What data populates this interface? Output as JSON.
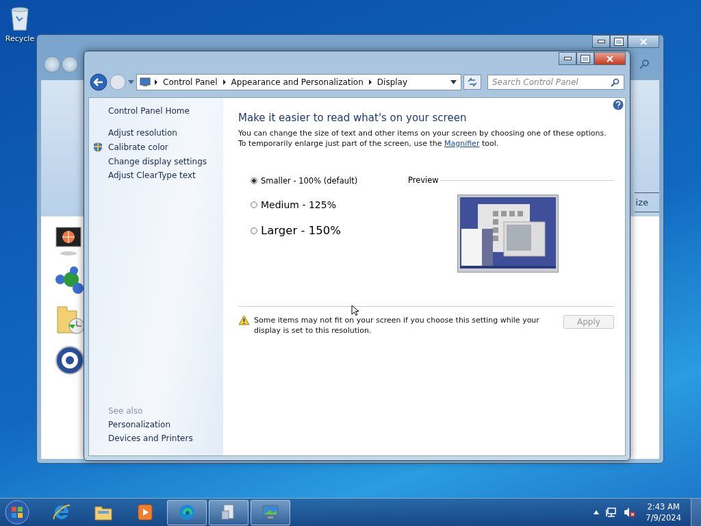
{
  "desktop": {
    "icons": [
      {
        "label": "Recycle",
        "kind": "recycle"
      }
    ]
  },
  "background_window": {
    "visible_text": "ize"
  },
  "window": {
    "address": {
      "crumbs": [
        "Control Panel",
        "Appearance and Personalization",
        "Display"
      ]
    },
    "search": {
      "placeholder": "Search Control Panel"
    },
    "sidebar": {
      "links": [
        {
          "label": "Control Panel Home",
          "kind": "home"
        },
        {
          "label": "Adjust resolution",
          "kind": "link"
        },
        {
          "label": "Calibrate color",
          "kind": "shield"
        },
        {
          "label": "Change display settings",
          "kind": "link"
        },
        {
          "label": "Adjust ClearType text",
          "kind": "link"
        }
      ],
      "see_also": {
        "heading": "See also",
        "links": [
          "Personalization",
          "Devices and Printers"
        ]
      }
    },
    "content": {
      "title": "Make it easier to read what's on your screen",
      "description": {
        "before": "You can change the size of text and other items on your screen by choosing one of these options. To temporarily enlarge just part of the screen, use the",
        "link": "Magnifier",
        "after": "tool."
      },
      "options": [
        {
          "label": "Smaller - 100% (default)",
          "kind": "small",
          "selected": true
        },
        {
          "label": "Medium - 125%",
          "kind": "medium",
          "selected": false
        },
        {
          "label": "Larger - 150%",
          "kind": "large",
          "selected": false
        }
      ],
      "preview_heading": "Preview",
      "warning": "Some items may not fit on your screen if you choose this setting while your display is set to this resolution.",
      "apply": {
        "label": "Apply",
        "disabled": true
      }
    }
  },
  "taskbar": {
    "items": [
      {
        "kind": "ie",
        "open": false
      },
      {
        "kind": "explorer",
        "open": false
      },
      {
        "kind": "media",
        "open": false
      },
      {
        "kind": "edge",
        "open": true
      },
      {
        "kind": "document",
        "open": true
      },
      {
        "kind": "display",
        "open": true
      }
    ],
    "clock": {
      "time": "2:43 AM",
      "date": "7/9/2024"
    }
  }
}
